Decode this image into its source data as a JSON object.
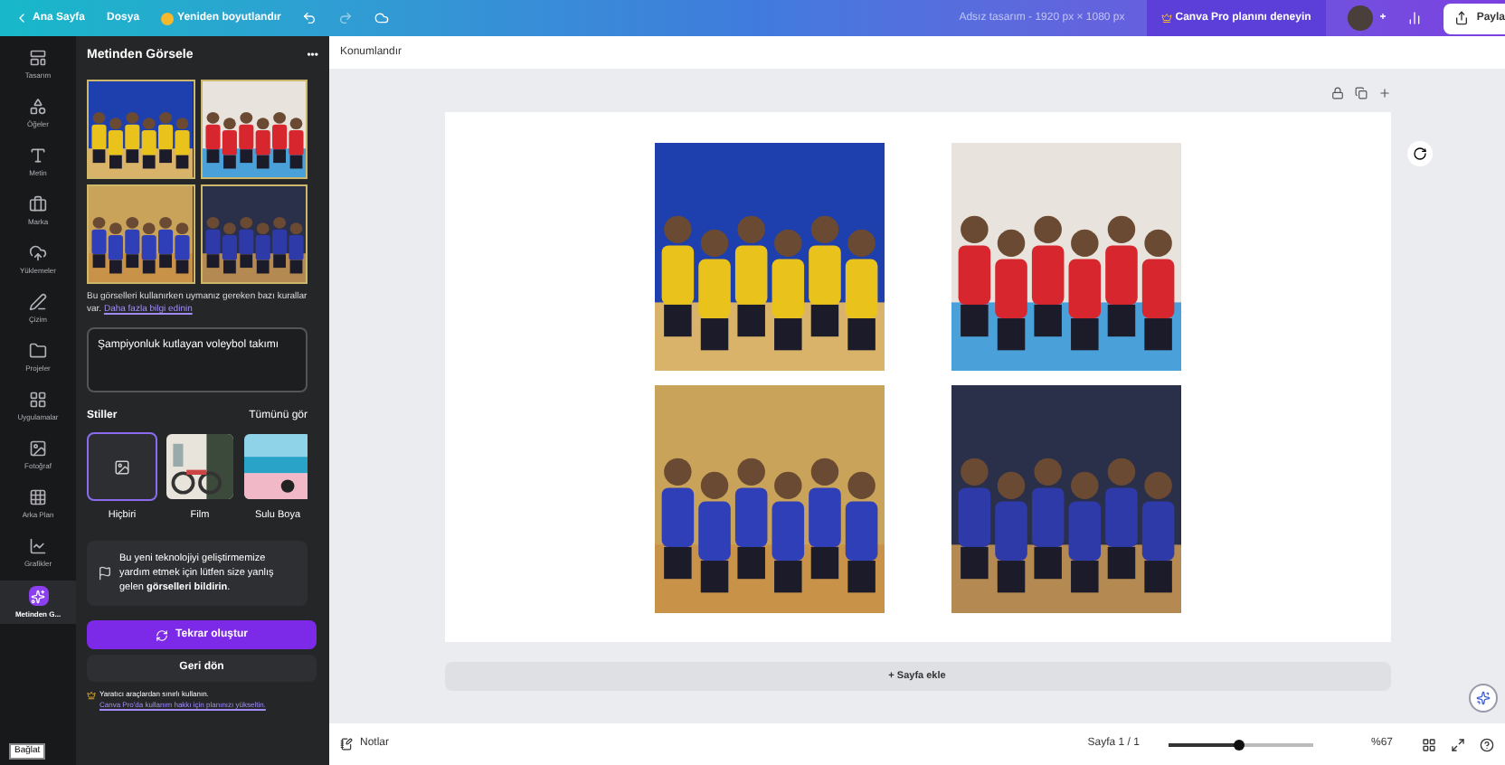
{
  "topbar": {
    "back": "Ana Sayfa",
    "file": "Dosya",
    "resize": "Yeniden boyutlandır",
    "design_title": "Adsız tasarım - 1920 px × 1080 px",
    "pro": "Canva Pro planını deneyin",
    "add": "+",
    "share": "Payla"
  },
  "rail": [
    {
      "label": "Tasarım",
      "selected": false
    },
    {
      "label": "Öğeler",
      "selected": false
    },
    {
      "label": "Metin",
      "selected": false
    },
    {
      "label": "Marka",
      "selected": false
    },
    {
      "label": "Yüklemeler",
      "selected": false
    },
    {
      "label": "Çizim",
      "selected": false
    },
    {
      "label": "Projeler",
      "selected": false
    },
    {
      "label": "Uygulamalar",
      "selected": false
    },
    {
      "label": "Fotoğraf",
      "selected": false
    },
    {
      "label": "Arka Plan",
      "selected": false
    },
    {
      "label": "Grafikler",
      "selected": false
    },
    {
      "label": "Metinden G...",
      "selected": true
    }
  ],
  "panel": {
    "title": "Metinden Görsele",
    "more": "•••",
    "notice": "Bu görselleri kullanırken uymanız gereken bazı kurallar var.",
    "notice_link": "Daha fazla bilgi edinin",
    "prompt": "Şampiyonluk kutlayan voleybol takımı",
    "styles_title": "Stiller",
    "styles_all": "Tümünü gör",
    "styles": [
      {
        "label": "Hiçbiri",
        "selected": true
      },
      {
        "label": "Film",
        "selected": false
      },
      {
        "label": "Sulu Boya",
        "selected": false
      }
    ],
    "feedback": "Bu yeni teknolojiyi geliştirmemize yardım etmek için lütfen size yanlış gelen **görselleri bildirin**.",
    "regenerate": "Tekrar oluştur",
    "back": "Geri dön",
    "footer": "Yaratıcı araçlardan sınırlı kullanın.",
    "footer_link": "Canva Pro'da kullanım hakkı için planınızı yükseltin.",
    "tooltip": "Bağlat"
  },
  "editor": {
    "position": "Konumlandır",
    "add_page": "+ Sayfa ekle"
  },
  "status_bar": {
    "notes": "Notlar",
    "page": "Sayfa 1 / 1",
    "zoom_slider": {
      "level": 0.49
    },
    "zoom": "%67"
  }
}
